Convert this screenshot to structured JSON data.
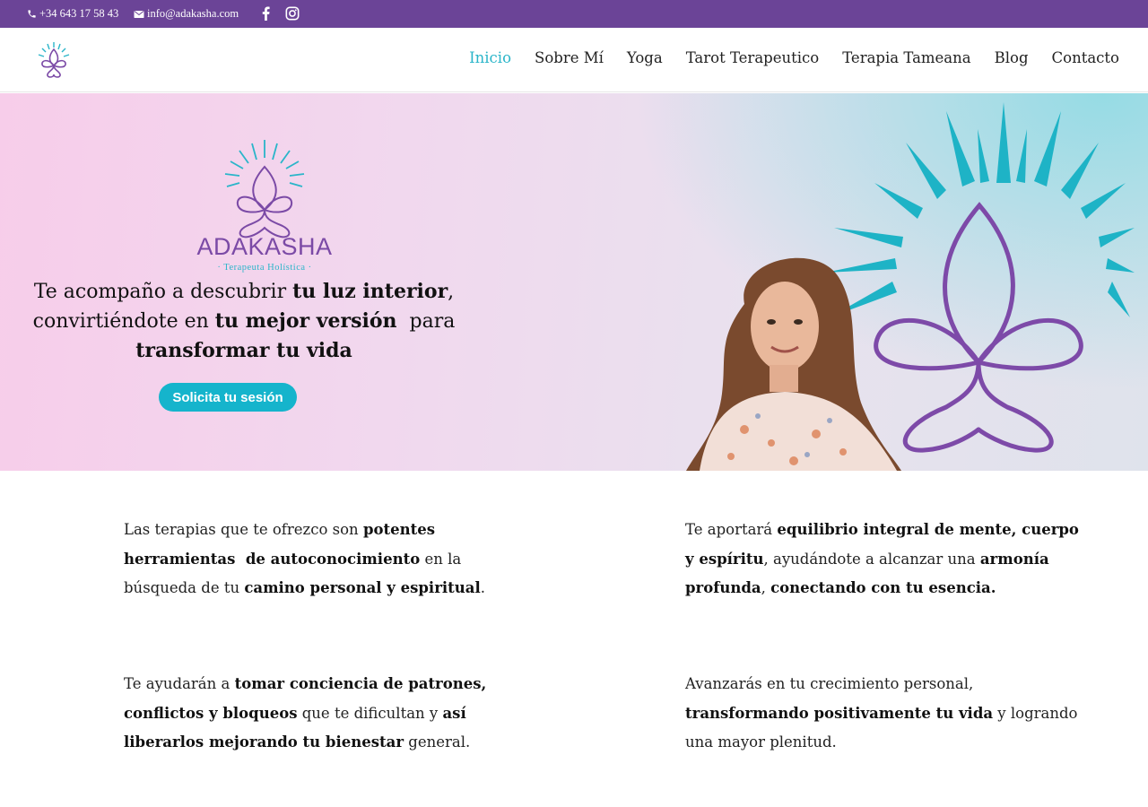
{
  "topbar": {
    "phone": "+34 643 17 58 43",
    "email": "info@adakasha.com",
    "icons": [
      "phone-icon",
      "mail-icon",
      "facebook-icon",
      "instagram-icon"
    ],
    "background": "#6b4497"
  },
  "nav": {
    "items": [
      "Inicio",
      "Sobre Mí",
      "Yoga",
      "Tarot Terapeutico",
      "Terapia Tameana",
      "Blog",
      "Contacto"
    ],
    "active": "Inicio",
    "active_color": "#2ab5c9"
  },
  "hero": {
    "brand": "ADAKASHA",
    "brand_sub": "· Terapeuta Holística ·",
    "tagline": {
      "l1_a": "Te acompaño a descubrir ",
      "l1_b": "tu luz interior",
      "l1_c": ",",
      "l2_a": "convirtiéndote en ",
      "l2_b": "tu mejor versión",
      "l2_c": "  para",
      "l3": "transformar tu vida"
    },
    "cta": "Solicita tu sesión",
    "cta_color": "#15b4cc"
  },
  "content": {
    "p1": {
      "a": "Las terapias que te ofrezco son ",
      "b": "potentes herramientas  de autoconocimiento",
      "c": " en la búsqueda de tu ",
      "d": "camino personal y espiritual",
      "e": "."
    },
    "p2": {
      "a": "Te aportará ",
      "b": "equilibrio integral de mente, cuerpo y espíritu",
      "c": ", ayudándote a alcanzar una ",
      "d": "armonía profunda",
      "e": ", ",
      "f": "conectando con tu esencia."
    },
    "p3": {
      "a": "Te ayudarán a ",
      "b": "tomar conciencia de patrones, conflictos y bloqueos",
      "c": " que te dificultan y ",
      "d": "así liberarlos mejorando tu bienestar",
      "e": " general."
    },
    "p4": {
      "a": "Avanzarás en tu crecimiento personal, ",
      "b": "transformando positivamente tu vida",
      "c": " y logrando una mayor plenitud."
    }
  }
}
